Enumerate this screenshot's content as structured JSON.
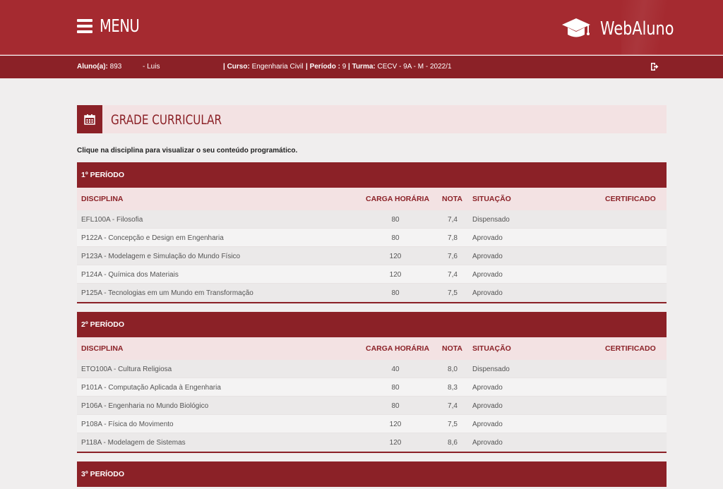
{
  "header": {
    "menu_label": "MENU",
    "brand_name": "WebAluno",
    "brand_color": "#a52a30",
    "icons": [
      "hamburger-icon",
      "graduation-cap-icon",
      "logout-icon"
    ]
  },
  "student": {
    "aluno_label": "Aluno(a):",
    "aluno_value": "893",
    "name": "- Luis",
    "curso_label": "| Curso:",
    "curso_value": "Engenharia Civil",
    "periodo_label": "| Período :",
    "periodo_value": "9",
    "turma_label": "| Turma:",
    "turma_value": "CECV - 9A - M - 2022/1"
  },
  "section": {
    "title": "GRADE CURRICULAR",
    "icon": "calendar-icon",
    "hint": "Clique na disciplina para visualizar o seu conteúdo programático."
  },
  "columns": {
    "disciplina": "DISCIPLINA",
    "carga": "CARGA HORÁRIA",
    "nota": "NOTA",
    "situacao": "SITUAÇÃO",
    "certificado": "CERTIFICADO"
  },
  "periods": [
    {
      "title": "1º PERÍODO",
      "rows": [
        {
          "disciplina": "EFL100A - Filosofia",
          "carga": "80",
          "nota": "7,4",
          "situacao": "Dispensado",
          "certificado": ""
        },
        {
          "disciplina": "P122A - Concepção e Design em Engenharia",
          "carga": "80",
          "nota": "7,8",
          "situacao": "Aprovado",
          "certificado": ""
        },
        {
          "disciplina": "P123A - Modelagem e Simulação do Mundo Físico",
          "carga": "120",
          "nota": "7,6",
          "situacao": "Aprovado",
          "certificado": ""
        },
        {
          "disciplina": "P124A - Química dos Materiais",
          "carga": "120",
          "nota": "7,4",
          "situacao": "Aprovado",
          "certificado": ""
        },
        {
          "disciplina": "P125A - Tecnologias em um Mundo em Transformação",
          "carga": "80",
          "nota": "7,5",
          "situacao": "Aprovado",
          "certificado": ""
        }
      ]
    },
    {
      "title": "2º PERÍODO",
      "rows": [
        {
          "disciplina": "ETO100A - Cultura Religiosa",
          "carga": "40",
          "nota": "8,0",
          "situacao": "Dispensado",
          "certificado": ""
        },
        {
          "disciplina": "P101A - Computação Aplicada à Engenharia",
          "carga": "80",
          "nota": "8,3",
          "situacao": "Aprovado",
          "certificado": ""
        },
        {
          "disciplina": "P106A - Engenharia no Mundo Biológico",
          "carga": "80",
          "nota": "7,4",
          "situacao": "Aprovado",
          "certificado": ""
        },
        {
          "disciplina": "P108A - Física do Movimento",
          "carga": "120",
          "nota": "7,5",
          "situacao": "Aprovado",
          "certificado": ""
        },
        {
          "disciplina": "P118A - Modelagem de Sistemas",
          "carga": "120",
          "nota": "8,6",
          "situacao": "Aprovado",
          "certificado": ""
        }
      ]
    },
    {
      "title": "3º PERÍODO",
      "rows": []
    }
  ]
}
